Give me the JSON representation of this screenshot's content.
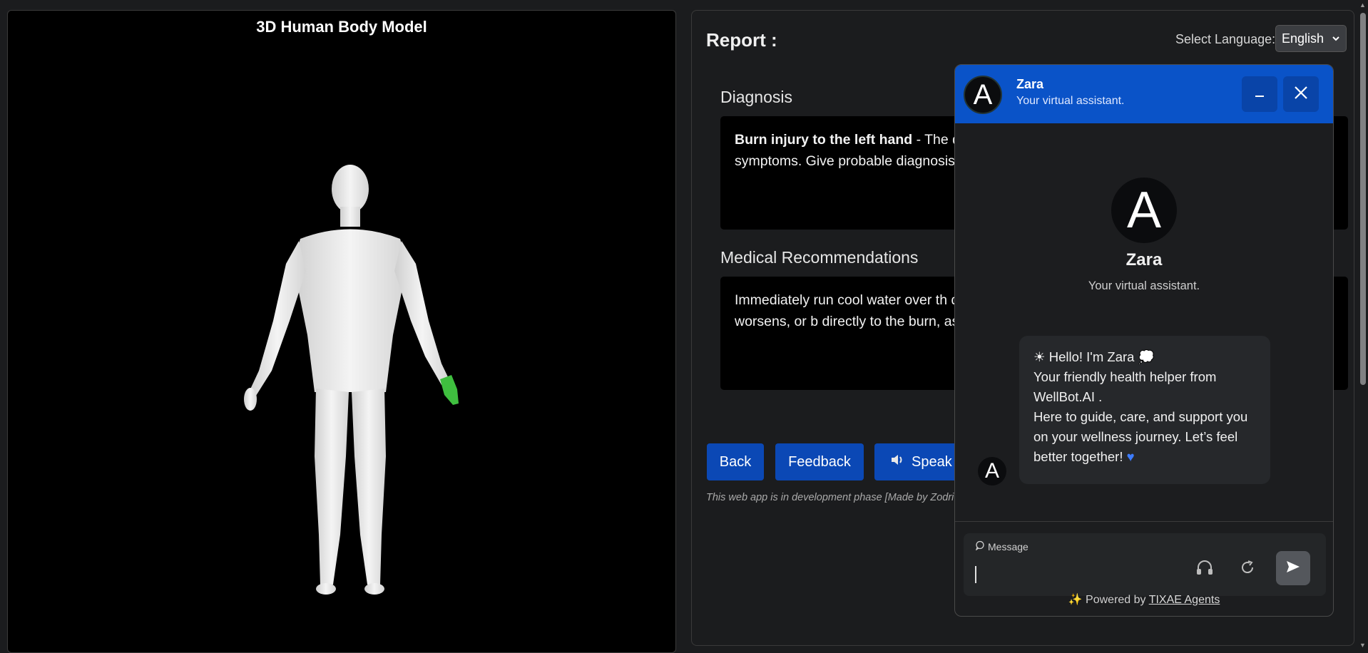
{
  "viewer": {
    "title": "3D Human Body Model",
    "highlight_color": "#3fbf3f"
  },
  "report": {
    "title": "Report :",
    "language_label": "Select Language:",
    "language_value": "English",
    "diagnosis_title": "Diagnosis",
    "diagnosis_bold": "Burn injury to the left hand",
    "diagnosis_text": " - The duration, with a severity of 3 and re consistent with the symptoms. Give probable diagnosis.",
    "recommendations_title": "Medical Recommendations",
    "recommendations_text": "Immediately run cool water over th damage. Apply a sterile, non-adhes pain persists, swelling worsens, or b directly to the burn, as it can cause",
    "buttons": {
      "back": "Back",
      "feedback": "Feedback",
      "speak": "Speak"
    },
    "dev_note": "This web app is in development phase [Made by Zodri"
  },
  "chat": {
    "name": "Zara",
    "subtitle": "Your virtual assistant.",
    "avatar_letter": "A",
    "greeting": "Hello! I'm Zara",
    "message_lines": [
      "Your friendly health helper from WellBot.AI .",
      "Here to guide, care, and support you on your wellness journey. Let’s feel better together!"
    ],
    "input_placeholder": "Message",
    "powered_prefix": "Powered by",
    "powered_link": "TIXAE Agents",
    "accent_color": "#0a53c8"
  }
}
